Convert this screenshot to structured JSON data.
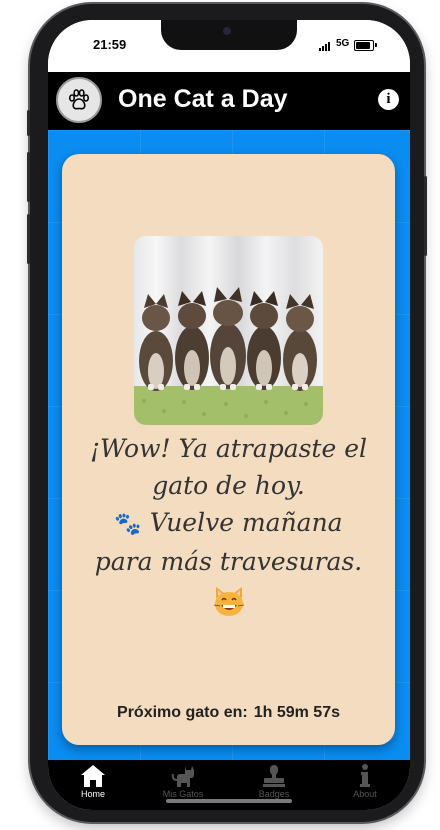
{
  "status_bar": {
    "time": "21:59",
    "network": "5G"
  },
  "header": {
    "title": "One Cat a Day",
    "logo_icon": "paw-icon",
    "info_icon": "info-icon",
    "info_label": "i"
  },
  "card": {
    "message_lines": [
      "¡Wow! Ya atrapaste el",
      "gato de hoy.",
      "Vuelve mañana",
      "para más travesuras."
    ],
    "paw_emoji": "🐾",
    "cat_emoji": "grinning-cat-icon",
    "timer_label": "Próximo gato en:",
    "timer_value": "1h 59m 57s"
  },
  "nav": {
    "items": [
      {
        "label": "Home",
        "icon": "home-icon",
        "active": true
      },
      {
        "label": "Mis Gatos",
        "icon": "cat-icon",
        "active": false
      },
      {
        "label": "Badges",
        "icon": "stamp-icon",
        "active": false
      },
      {
        "label": "About",
        "icon": "info-icon",
        "active": false
      }
    ]
  },
  "colors": {
    "background": "#0a8cf0",
    "card": "#f3dcc0",
    "header": "#000000"
  }
}
